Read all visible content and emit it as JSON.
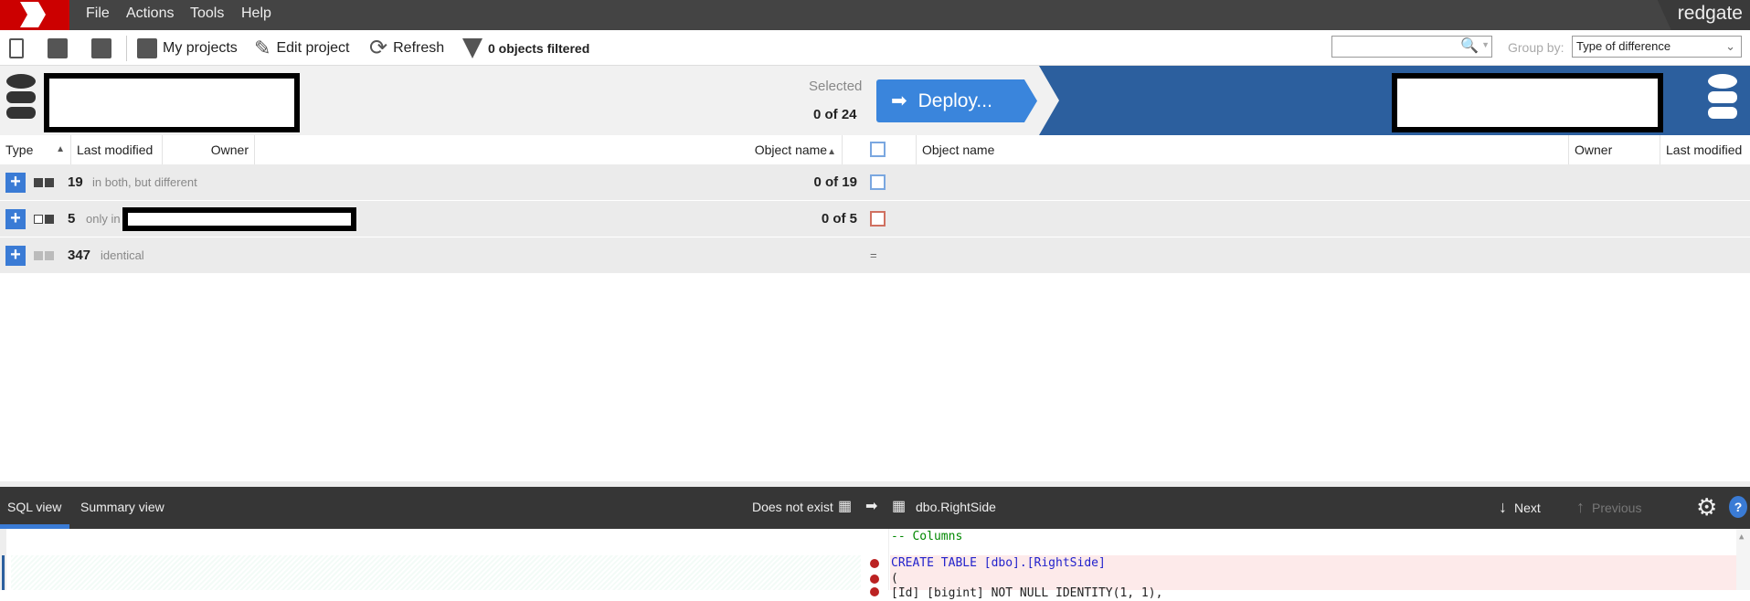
{
  "menu": {
    "items": [
      "File",
      "Actions",
      "Tools",
      "Help"
    ],
    "brand": "redgate"
  },
  "toolbar": {
    "my_projects": "My projects",
    "edit_project": "Edit project",
    "refresh": "Refresh",
    "filtered": "0 objects filtered",
    "search_placeholder": "",
    "group_by_label": "Group by:",
    "group_by_value": "Type of difference"
  },
  "header": {
    "selected_label": "Selected",
    "selected_value": "0 of 24",
    "deploy_label": "Deploy..."
  },
  "columns_left": [
    "Type",
    "Last modified",
    "Owner",
    "Object name"
  ],
  "columns_right": [
    "Object name",
    "Owner",
    "Last modified"
  ],
  "groups": [
    {
      "count": "19",
      "desc": "in both, but different",
      "selected": "0 of 19",
      "color": "#7aa7e0"
    },
    {
      "count": "5",
      "desc": "only in",
      "selected": "0 of 5",
      "color": "#d07060"
    },
    {
      "count": "347",
      "desc": "identical",
      "selected": "",
      "mark": "="
    }
  ],
  "bottom": {
    "tabs": [
      "SQL view",
      "Summary view"
    ],
    "left_object": "Does not exist",
    "right_object": "dbo.RightSide",
    "next": "Next",
    "previous": "Previous"
  },
  "code": {
    "lines": [
      "-- Columns",
      "",
      "CREATE TABLE [dbo].[RightSide]",
      "(",
      "[Id] [bigint] NOT NULL IDENTITY(1, 1),"
    ]
  },
  "colors": {
    "accent": "#3a85dc",
    "band": "#2c5f9e",
    "logo": "#cc0000",
    "dark": "#363636"
  }
}
